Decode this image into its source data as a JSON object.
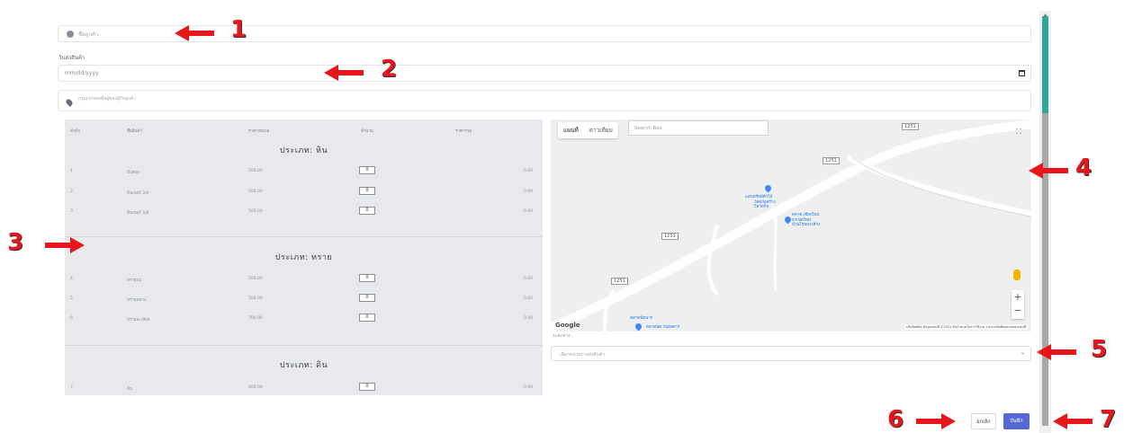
{
  "form": {
    "customer_placeholder": "ชื่อลูกค้า",
    "date_label": "วันส่งสินค้า",
    "date_placeholder": "mm/dd/yyyy",
    "address_placeholder": "กรุณากรอกที่อยู่ของผู้รับลูกค้า"
  },
  "products": {
    "headers": [
      "ลำดับ",
      "ชื่อสินค้า",
      "ราคา/หน่วย",
      "จำนวน",
      "ราคารวม"
    ],
    "categories": [
      {
        "title": "ประเภท: หิน",
        "rows": [
          {
            "no": "1",
            "name": "หินคลุก",
            "price": "500.00",
            "qty": "0",
            "total": "0.00"
          },
          {
            "no": "2",
            "name": "หินเบอร์ 3/4",
            "price": "500.00",
            "qty": "0",
            "total": "0.00"
          },
          {
            "no": "3",
            "name": "หินเบอร์ 3/8",
            "price": "500.00",
            "qty": "0",
            "total": "0.00"
          }
        ]
      },
      {
        "title": "ประเภท: ทราย",
        "rows": [
          {
            "no": "4",
            "name": "ทรายถม",
            "price": "500.00",
            "qty": "0",
            "total": "0.00"
          },
          {
            "no": "5",
            "name": "ทรายหยาบ",
            "price": "500.00",
            "qty": "0",
            "total": "0.00"
          },
          {
            "no": "6",
            "name": "ทรายละเอียด",
            "price": "700.00",
            "qty": "0",
            "total": "0.00"
          }
        ]
      },
      {
        "title": "ประเภท: ดิน",
        "rows": [
          {
            "no": "7",
            "name": "ดิน",
            "price": "400.00",
            "qty": "0",
            "total": "0.00"
          }
        ]
      }
    ]
  },
  "map": {
    "tab_map": "แผนที่",
    "tab_satellite": "ดาวเทียม",
    "search_placeholder": "Search Box",
    "fullscreen_icon": "fullscreen-icon",
    "road_labels": [
      "1251",
      "1251",
      "1251",
      "1251"
    ],
    "places": [
      {
        "name": "แสนทรัพย์ค้าไม้",
        "sub": "วัสดุก่อสร้าง\nวิสาหกิจ"
      },
      {
        "name": "ตลาด เชียงใหม่",
        "sub": "อาเขตใหม่\nบ้านไร่หลวงค้าง"
      },
      {
        "name": "ตลาดนัด วันอังคาร",
        "sub": "ตลาดนัดนาก"
      }
    ],
    "google_label": "Google",
    "attribution": "แป้นพิมพ์ลัด   ข้อมูลแผนที่ ©2021   ข้อกำหนดในการใช้งาน   รายงานข้อผิดพลาดของแผนที่",
    "zoom_in": "+",
    "zoom_out": "−"
  },
  "below_map_label": "ระยะทาง :",
  "bank_select_placeholder": "เลือกหน่วยงานส่งสินค้า",
  "buttons": {
    "cancel": "ยกเลิก",
    "save": "บันทึก"
  },
  "annotations": [
    "1",
    "2",
    "3",
    "4",
    "5",
    "6",
    "7"
  ],
  "colors": {
    "accent": "#5469d4",
    "scroll_thumb": "#2ea89b",
    "annotation": "#e8151d"
  }
}
